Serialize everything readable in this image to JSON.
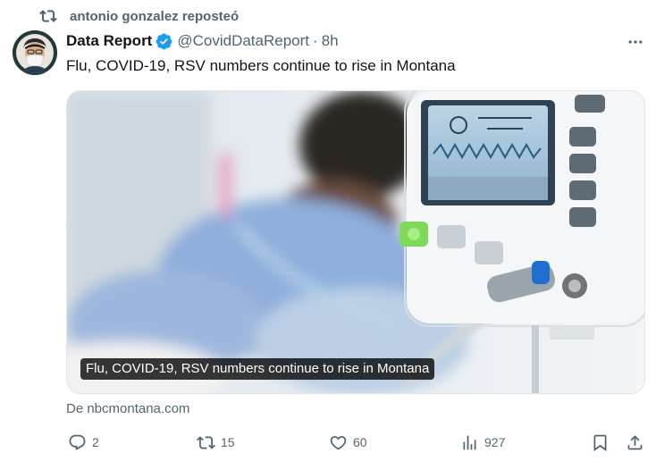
{
  "repost": {
    "icon": "repost-icon",
    "text": "antonio gonzalez reposteó"
  },
  "author": {
    "name": "Data Report",
    "verified_icon": "verified-badge-icon",
    "handle": "@CovidDataReport",
    "separator": "·",
    "time": "8h"
  },
  "tweet": {
    "text": "Flu, COVID-19, RSV numbers continue to rise in Montana"
  },
  "card": {
    "caption": "Flu, COVID-19, RSV numbers continue to rise in Montana",
    "source": "De nbcmontana.com"
  },
  "actions": {
    "replies": "2",
    "reposts": "15",
    "likes": "60",
    "views": "927"
  },
  "colors": {
    "text_primary": "#0f1419",
    "text_secondary": "#536471",
    "verified": "#1d9bf0",
    "monitor_green": "#7ed957"
  }
}
